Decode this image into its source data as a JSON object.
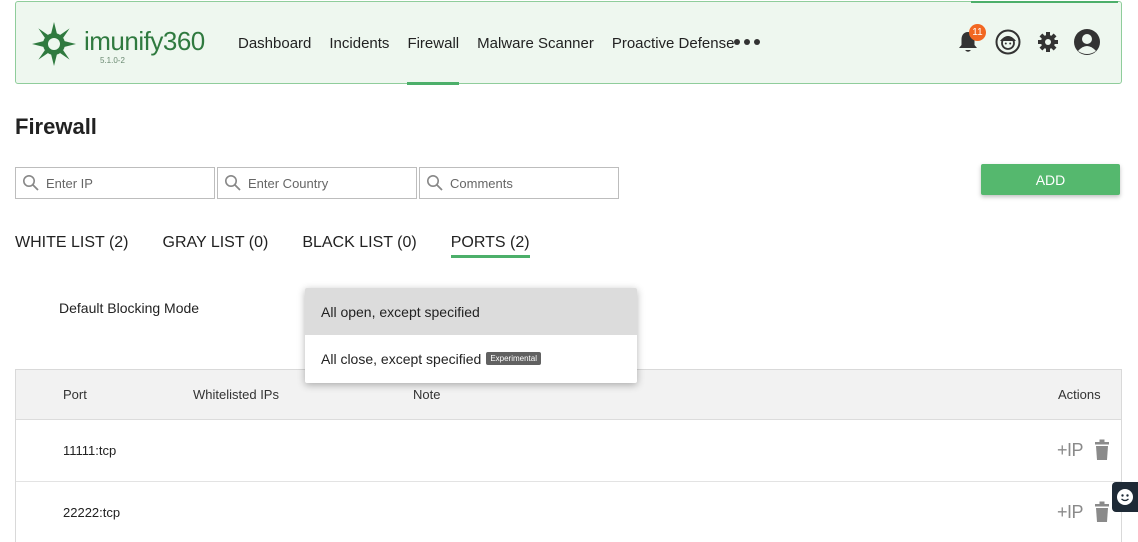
{
  "header": {
    "brand": {
      "name_prefix": "imunify",
      "name_suffix": "360",
      "version": "5.1.0-2"
    },
    "nav": [
      {
        "label": "Dashboard"
      },
      {
        "label": "Incidents"
      },
      {
        "label": "Firewall"
      },
      {
        "label": "Malware Scanner"
      },
      {
        "label": "Proactive Defense"
      }
    ],
    "active_nav": "Firewall",
    "notifications_count": "11",
    "accent_color": "#4caf6a",
    "badge_color": "#f26722"
  },
  "page": {
    "title": "Firewall"
  },
  "filters": {
    "ip_placeholder": "Enter IP",
    "country_placeholder": "Enter Country",
    "comments_placeholder": "Comments"
  },
  "add_button": {
    "label": "ADD"
  },
  "tabs": [
    {
      "label": "WHITE LIST (2)"
    },
    {
      "label": "GRAY LIST (0)"
    },
    {
      "label": "BLACK LIST (0)"
    },
    {
      "label": "PORTS (2)"
    }
  ],
  "active_tab": "PORTS (2)",
  "blocking_mode": {
    "label": "Default Blocking Mode",
    "options": [
      {
        "label": "All open, except specified",
        "tag": ""
      },
      {
        "label": "All close, except specified",
        "tag": "Experimental"
      }
    ],
    "selected": "All open, except specified"
  },
  "table": {
    "columns": [
      "Port",
      "Whitelisted IPs",
      "Note",
      "Actions"
    ],
    "rows": [
      {
        "port": "11111:tcp",
        "whitelisted_ips": "",
        "note": ""
      },
      {
        "port": "22222:tcp",
        "whitelisted_ips": "",
        "note": ""
      }
    ],
    "add_ip_label": "+IP"
  }
}
